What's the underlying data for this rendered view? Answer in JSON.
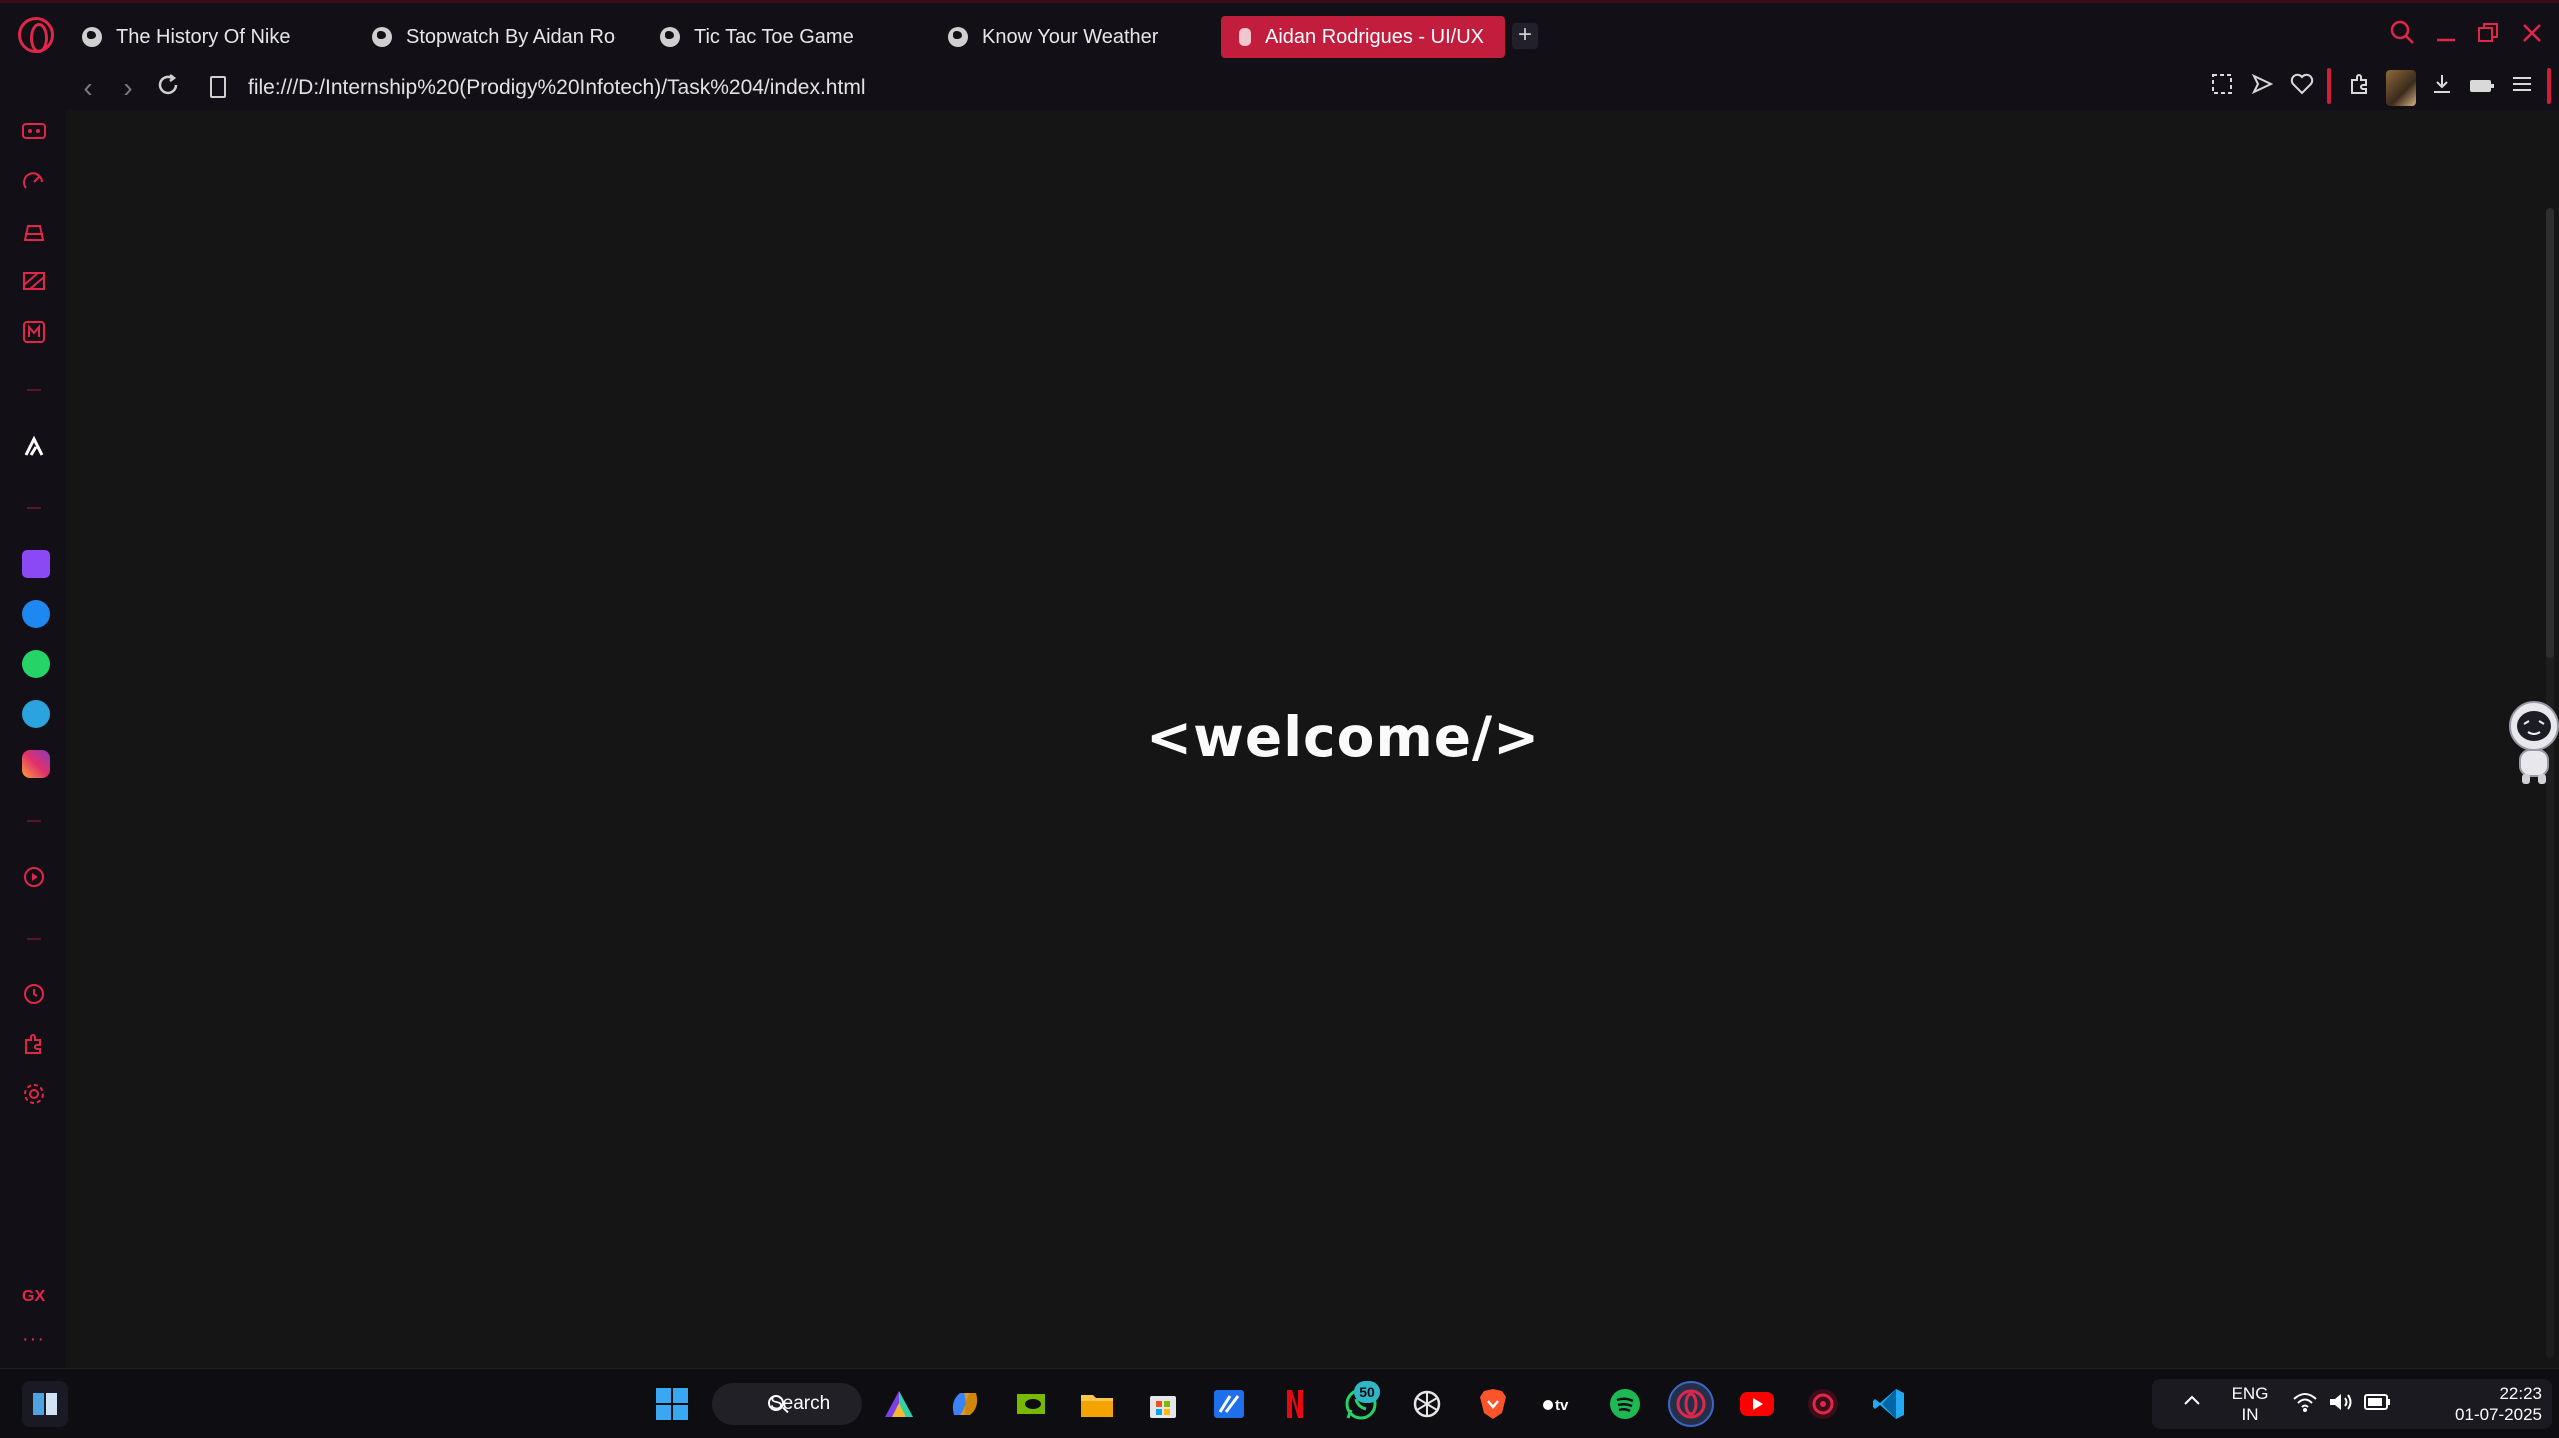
{
  "browser": {
    "tabs": [
      {
        "title": "The History Of Nike",
        "active": false
      },
      {
        "title": "Stopwatch By Aidan Rodr",
        "active": false
      },
      {
        "title": "Tic Tac Toe Game",
        "active": false
      },
      {
        "title": "Know Your Weather",
        "active": false
      },
      {
        "title": "Aidan Rodrigues - UI/UX D",
        "active": true
      }
    ],
    "new_tab_label": "+",
    "url": "file:///D:/Internship%20(Prodigy%20Infotech)/Task%204/index.html",
    "accent_color": "#e0274a"
  },
  "page": {
    "heading": "<welcome/>"
  },
  "sidebar": {
    "gx_label": "GX",
    "more_label": "···"
  },
  "taskbar": {
    "search_label": "Search",
    "whatsapp_badge": "50",
    "language_line1": "ENG",
    "language_line2": "IN",
    "time": "22:23",
    "date": "01-07-2025"
  }
}
